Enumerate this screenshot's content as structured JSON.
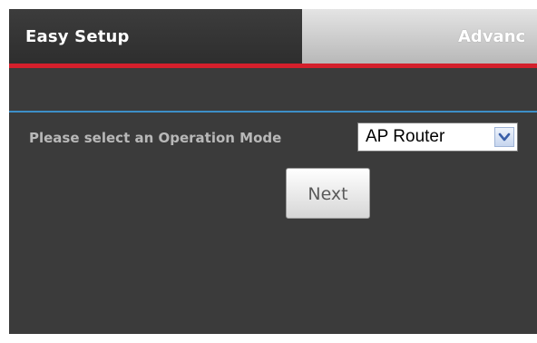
{
  "tabs": {
    "easy_setup": "Easy Setup",
    "advanced": "Advanc"
  },
  "form": {
    "mode_label": "Please select an Operation Mode",
    "mode_selected": "AP Router",
    "next_label": "Next"
  },
  "icons": {
    "dropdown": "chevron-down-icon"
  },
  "colors": {
    "background": "#3b3b3b",
    "accent_red": "#d4202c",
    "divider_blue": "#3d8fc8",
    "active_tab": "#2e2e2e",
    "inactive_tab": "#c8c8c8"
  }
}
